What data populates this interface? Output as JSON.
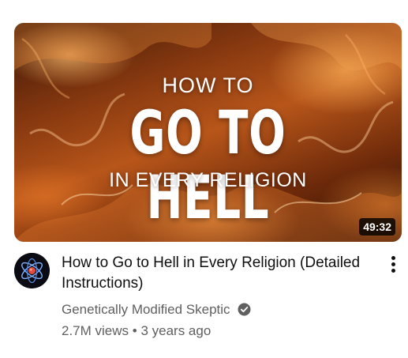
{
  "video": {
    "thumbnail": {
      "line1": "HOW TO",
      "line2": "GO TO HELL",
      "line3": "IN EVERY RELIGION"
    },
    "duration": "49:32",
    "title": "How to Go to Hell in Every Religion (Detailed Instructions)",
    "channel": "Genetically Modified Skeptic",
    "views": "2.7M views",
    "separator": "•",
    "age": "3 years ago"
  },
  "icons": {
    "menu": "more-vert-icon",
    "verified": "verified-badge-icon",
    "avatar": "channel-avatar"
  },
  "colors": {
    "title": "#0f0f0f",
    "secondary": "#606060",
    "duration_bg": "#000000cc"
  }
}
